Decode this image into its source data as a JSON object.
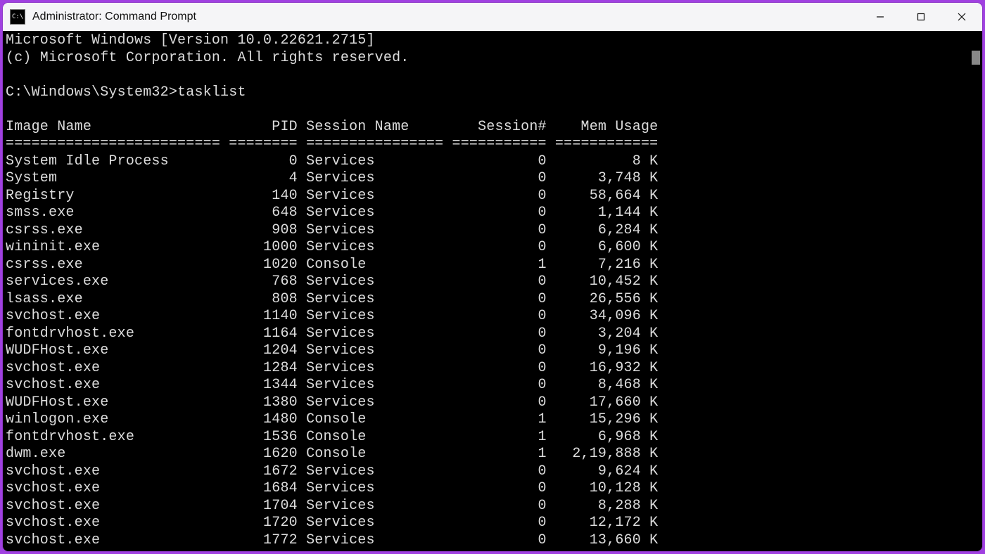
{
  "window": {
    "title": "Administrator: Command Prompt"
  },
  "terminal": {
    "banner1": "Microsoft Windows [Version 10.0.22621.2715]",
    "banner2": "(c) Microsoft Corporation. All rights reserved.",
    "prompt_path": "C:\\Windows\\System32>",
    "command": "tasklist",
    "headers": {
      "image_name": "Image Name",
      "pid": "PID",
      "session_name": "Session Name",
      "session_num": "Session#",
      "mem_usage": "Mem Usage"
    },
    "rows": [
      {
        "name": "System Idle Process",
        "pid": "0",
        "sess": "Services",
        "snum": "0",
        "mem": "8 K"
      },
      {
        "name": "System",
        "pid": "4",
        "sess": "Services",
        "snum": "0",
        "mem": "3,748 K"
      },
      {
        "name": "Registry",
        "pid": "140",
        "sess": "Services",
        "snum": "0",
        "mem": "58,664 K"
      },
      {
        "name": "smss.exe",
        "pid": "648",
        "sess": "Services",
        "snum": "0",
        "mem": "1,144 K"
      },
      {
        "name": "csrss.exe",
        "pid": "908",
        "sess": "Services",
        "snum": "0",
        "mem": "6,284 K"
      },
      {
        "name": "wininit.exe",
        "pid": "1000",
        "sess": "Services",
        "snum": "0",
        "mem": "6,600 K"
      },
      {
        "name": "csrss.exe",
        "pid": "1020",
        "sess": "Console",
        "snum": "1",
        "mem": "7,216 K"
      },
      {
        "name": "services.exe",
        "pid": "768",
        "sess": "Services",
        "snum": "0",
        "mem": "10,452 K"
      },
      {
        "name": "lsass.exe",
        "pid": "808",
        "sess": "Services",
        "snum": "0",
        "mem": "26,556 K"
      },
      {
        "name": "svchost.exe",
        "pid": "1140",
        "sess": "Services",
        "snum": "0",
        "mem": "34,096 K"
      },
      {
        "name": "fontdrvhost.exe",
        "pid": "1164",
        "sess": "Services",
        "snum": "0",
        "mem": "3,204 K"
      },
      {
        "name": "WUDFHost.exe",
        "pid": "1204",
        "sess": "Services",
        "snum": "0",
        "mem": "9,196 K"
      },
      {
        "name": "svchost.exe",
        "pid": "1284",
        "sess": "Services",
        "snum": "0",
        "mem": "16,932 K"
      },
      {
        "name": "svchost.exe",
        "pid": "1344",
        "sess": "Services",
        "snum": "0",
        "mem": "8,468 K"
      },
      {
        "name": "WUDFHost.exe",
        "pid": "1380",
        "sess": "Services",
        "snum": "0",
        "mem": "17,660 K"
      },
      {
        "name": "winlogon.exe",
        "pid": "1480",
        "sess": "Console",
        "snum": "1",
        "mem": "15,296 K"
      },
      {
        "name": "fontdrvhost.exe",
        "pid": "1536",
        "sess": "Console",
        "snum": "1",
        "mem": "6,968 K"
      },
      {
        "name": "dwm.exe",
        "pid": "1620",
        "sess": "Console",
        "snum": "1",
        "mem": "2,19,888 K"
      },
      {
        "name": "svchost.exe",
        "pid": "1672",
        "sess": "Services",
        "snum": "0",
        "mem": "9,624 K"
      },
      {
        "name": "svchost.exe",
        "pid": "1684",
        "sess": "Services",
        "snum": "0",
        "mem": "10,128 K"
      },
      {
        "name": "svchost.exe",
        "pid": "1704",
        "sess": "Services",
        "snum": "0",
        "mem": "8,288 K"
      },
      {
        "name": "svchost.exe",
        "pid": "1720",
        "sess": "Services",
        "snum": "0",
        "mem": "12,172 K"
      },
      {
        "name": "svchost.exe",
        "pid": "1772",
        "sess": "Services",
        "snum": "0",
        "mem": "13,660 K"
      }
    ]
  }
}
